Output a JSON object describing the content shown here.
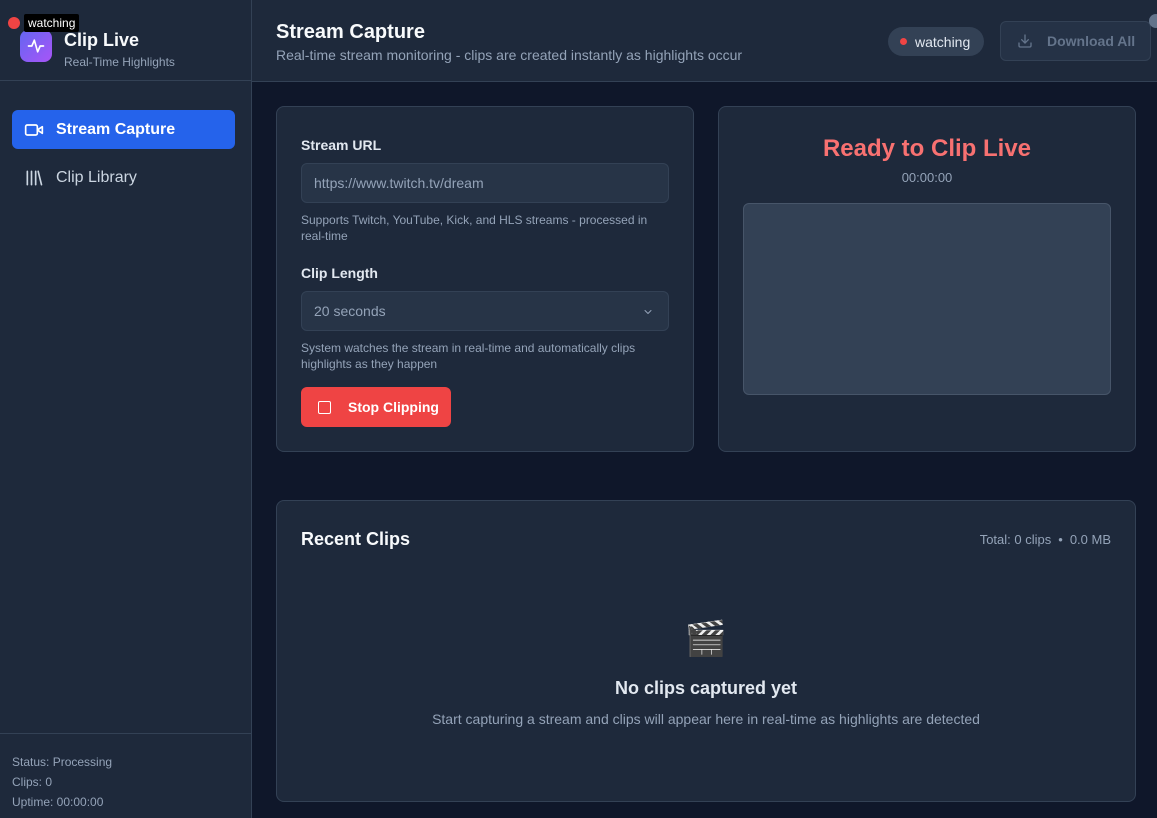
{
  "sidebar": {
    "app_name": "Clip Live",
    "app_subtitle": "Real-Time Highlights",
    "tooltip": "watching",
    "items": [
      {
        "label": "Stream Capture",
        "icon": "video-camera-icon",
        "active": true
      },
      {
        "label": "Clip Library",
        "icon": "library-icon",
        "active": false
      }
    ],
    "footer": {
      "status": "Status: Processing",
      "clips": "Clips: 0",
      "uptime": "Uptime: 00:00:00"
    }
  },
  "header": {
    "title": "Stream Capture",
    "subtitle": "Real-time stream monitoring - clips are created instantly as highlights occur",
    "status_badge": "watching",
    "download_all_label": "Download All"
  },
  "form": {
    "stream_url_label": "Stream URL",
    "stream_url_placeholder": "https://www.twitch.tv/dream",
    "stream_url_value": "",
    "stream_url_hint": "Supports Twitch, YouTube, Kick, and HLS streams - processed in real-time",
    "clip_length_label": "Clip Length",
    "clip_length_value": "20 seconds",
    "clip_length_hint": "System watches the stream in real-time and automatically clips highlights as they happen",
    "stop_button_label": "Stop Clipping"
  },
  "preview": {
    "title": "Ready to Clip Live",
    "timer": "00:00:00"
  },
  "clips": {
    "title": "Recent Clips",
    "total": "Total: 0 clips",
    "separator": "•",
    "size": "0.0 MB",
    "empty_icon": "🎬",
    "empty_title": "No clips captured yet",
    "empty_subtitle": "Start capturing a stream and clips will appear here in real-time as highlights are detected"
  },
  "colors": {
    "accent": "#2563eb",
    "danger": "#ef4444",
    "ready_title": "#f87171",
    "background": "#0f172a",
    "panel": "#1e293b"
  }
}
